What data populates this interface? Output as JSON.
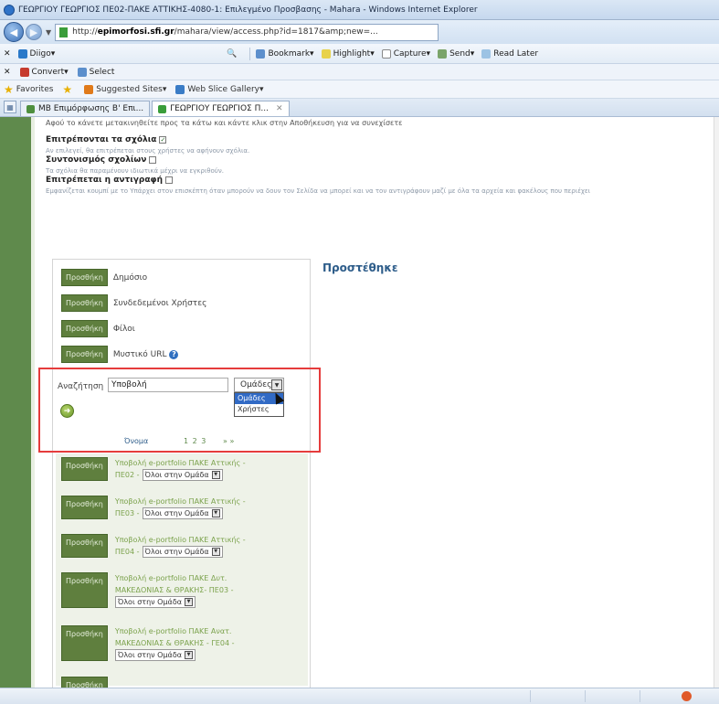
{
  "window": {
    "title": "ΓΕΩΡΓΙΟΥ ΓΕΩΡΓΙΟΣ ΠΕ02-ΠΑΚΕ ΑΤΤΙΚΗΣ-4080-1: Επιλεγμένο Προσβασης - Mahara - Windows Internet Explorer"
  },
  "address_bar": {
    "url_prefix": "http://",
    "url_host": "epimorfosi.sfi.gr",
    "url_path": "/mahara/view/access.php?id=1817&amp;new=..."
  },
  "toolbar": {
    "items": [
      "Bookmark",
      "Highlight",
      "Capture",
      "Send",
      "Read Later"
    ],
    "left_items": [
      "Diigo"
    ]
  },
  "convert_row": {
    "items": [
      "Convert",
      "Select"
    ]
  },
  "favorites": {
    "items": [
      "Favorites",
      "Suggested Sites",
      "Web Slice Gallery"
    ]
  },
  "tabs": [
    {
      "label": "MB Επιμόρφωσης Β' Επι...",
      "active": false
    },
    {
      "label": "ΓΕΩΡΓΙΟΥ ΓΕΩΡΓΙΟΣ Π...",
      "active": true
    }
  ],
  "content": {
    "intro": "Αφού το κάνετε μετακινηθείτε προς τα κάτω και κάντε κλικ στην Αποθήκευση για να συνεχίσετε",
    "allow_comments_label": "Επιτρέπονται τα σχόλια",
    "allow_comments_desc": "Αν επιλεγεί, θα επιτρέπεται στους χρήστες να αφήνουν σχόλια.",
    "moderate_comments_label": "Συντονισμός σχολίων",
    "moderate_comments_desc": "Τα σχόλια θα παραμένουν ιδιωτικά μέχρι να εγκριθούν.",
    "allow_copy_label": "Επιτρέπεται η αντιγραφή",
    "allow_copy_desc": "Εμφανίζεται κουμπί με το Υπάρχει στον επισκέπτη όταν μπορούν να δουν τον Σελίδα να μπορεί και να τον αντιγράφουν μαζί με όλα τα αρχεία και φακέλους που περιέχει"
  },
  "panel": {
    "add_label": "Προσθήκη",
    "rows": [
      "Δημόσιο",
      "Συνδεδεμένοι Χρήστες",
      "Φίλοι",
      "Μυστικό URL"
    ],
    "search_label": "Αναζήτηση",
    "search_value": "Υποβολή",
    "select_value": "Ομάδες",
    "options": [
      "Ομάδες",
      "Χρήστες"
    ],
    "pager_label": "Όνομα",
    "pager_nums": "1 2 3",
    "pager_next": "» »",
    "groups": [
      {
        "line1": "Υποβολή e-portfolio ΠΑΚΕ Αττικής -",
        "line2": "ΠΕ02 -",
        "role": "Όλοι στην Ομάδα"
      },
      {
        "line1": "Υποβολή e-portfolio ΠΑΚΕ Αττικής -",
        "line2": "ΠΕ03 -",
        "role": "Όλοι στην Ομάδα"
      },
      {
        "line1": "Υποβολή e-portfolio ΠΑΚΕ Αττικής -",
        "line2": "ΠΕ04 -",
        "role": "Όλοι στην Ομάδα"
      },
      {
        "line1": "Υποβολή e-portfolio ΠΑΚΕ Δυτ.",
        "line2": "ΜΑΚΕΔΟΝΙΑΣ & ΘΡΑΚΗΣ- ΠΕ03 -",
        "role": "Όλοι στην Ομάδα"
      },
      {
        "line1": "Υποβολή e-portfolio ΠΑΚΕ Ανατ.",
        "line2": "ΜΑΚΕΔΟΝΙΑΣ & ΘΡΑΚΗΣ - ΓΕ04 -",
        "role": "Όλοι στην Ομάδα"
      }
    ]
  },
  "added_heading": "Προστέθηκε"
}
